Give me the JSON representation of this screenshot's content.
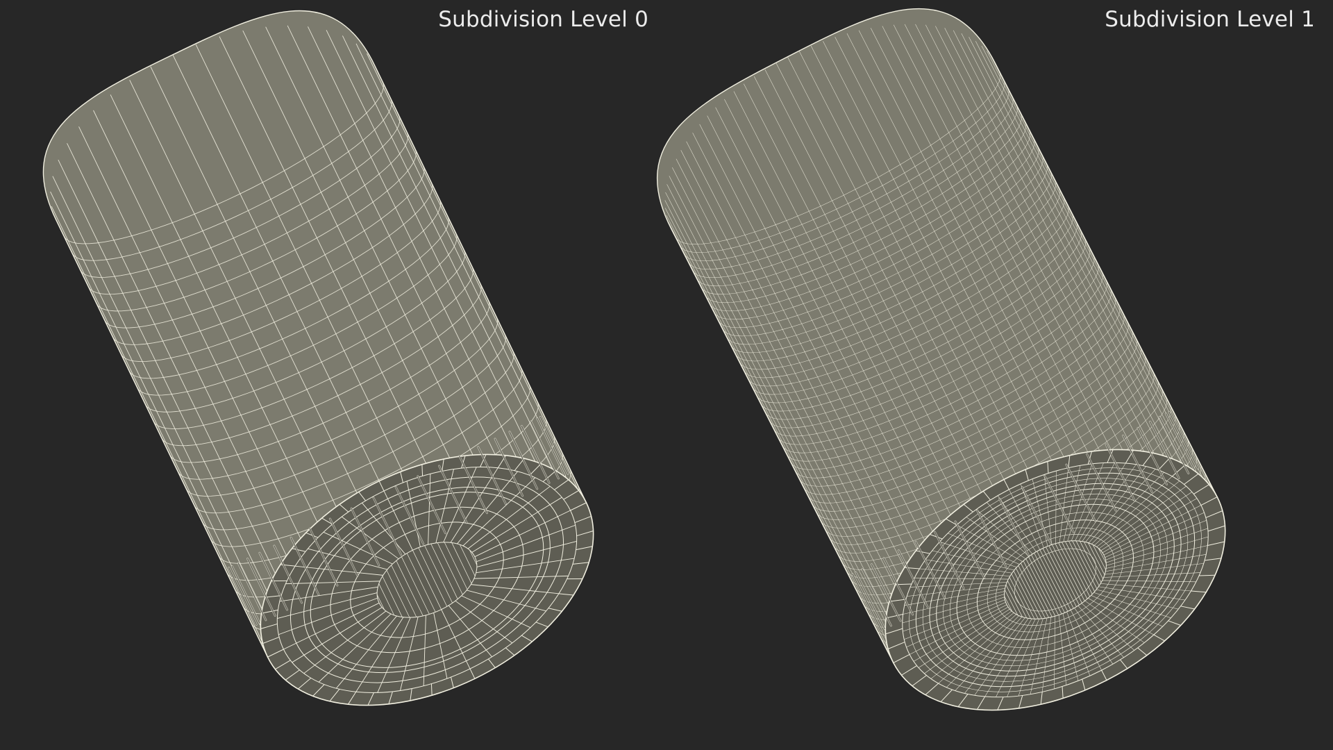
{
  "panels": [
    {
      "label": "Subdivision Level 0",
      "subdivision_level": 0
    },
    {
      "label": "Subdivision Level 1",
      "subdivision_level": 1
    }
  ],
  "colors": {
    "background": "#272727",
    "surface": "#7c7b6e",
    "surface_dark": "#5e5d53",
    "wire": "#f2f0e1",
    "label": "#ececec"
  }
}
